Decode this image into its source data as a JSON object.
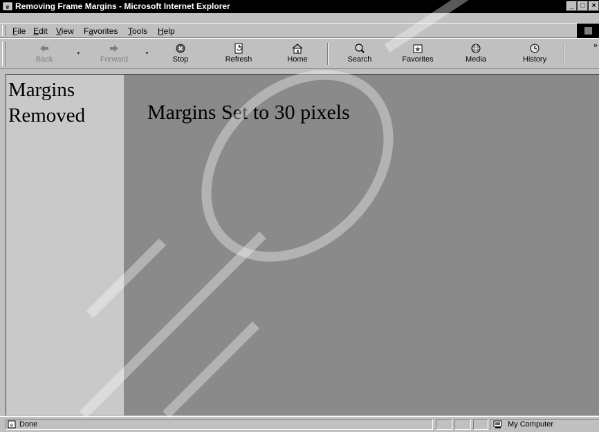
{
  "window": {
    "title": "Removing Frame Margins - Microsoft Internet Explorer",
    "controls": [
      "_",
      "□",
      "×"
    ]
  },
  "menu": {
    "items": [
      {
        "pre": "",
        "ul": "F",
        "post": "ile"
      },
      {
        "pre": "",
        "ul": "E",
        "post": "dit"
      },
      {
        "pre": "",
        "ul": "V",
        "post": "iew"
      },
      {
        "pre": "F",
        "ul": "a",
        "post": "vorites"
      },
      {
        "pre": "",
        "ul": "T",
        "post": "ools"
      },
      {
        "pre": "",
        "ul": "H",
        "post": "elp"
      }
    ]
  },
  "toolbar": {
    "back": "Back",
    "forward": "Forward",
    "stop": "Stop",
    "refresh": "Refresh",
    "home": "Home",
    "search": "Search",
    "favorites": "Favorites",
    "media": "Media",
    "history": "History",
    "chevron": "»"
  },
  "icons": {
    "back": "back-arrow-icon",
    "forward": "forward-arrow-icon",
    "stop": "stop-icon",
    "refresh": "refresh-icon",
    "home": "home-icon",
    "search": "search-icon",
    "favorites": "favorites-icon",
    "media": "media-icon",
    "history": "history-icon"
  },
  "content": {
    "left_frame_text": "Margins Removed",
    "right_frame_text": "Margins Set to 30 pixels"
  },
  "status": {
    "text": "Done",
    "zone": "My Computer"
  },
  "colors": {
    "left_frame_bg": "#c9c9c9",
    "right_frame_bg": "#8a8a8a",
    "chrome": "#c0c0c0"
  }
}
